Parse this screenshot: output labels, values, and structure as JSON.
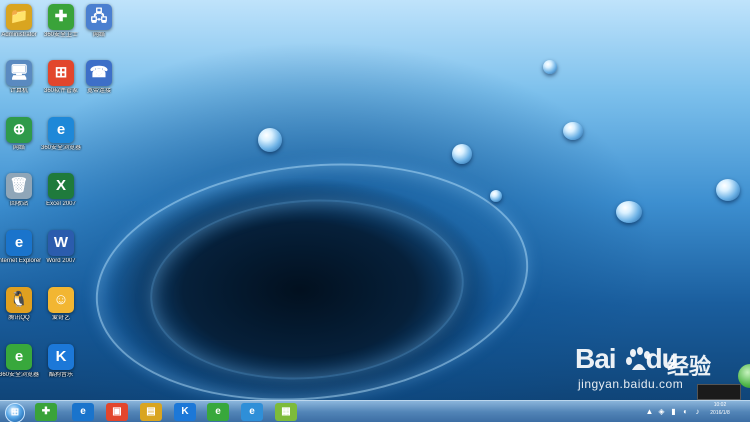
{
  "desktop_icons": [
    {
      "label": "Administrator",
      "color": "#d9a520",
      "glyph": "📁",
      "col": 0,
      "row": 0
    },
    {
      "label": "360安全卫士",
      "color": "#3aa33a",
      "glyph": "✚",
      "col": 1,
      "row": 0
    },
    {
      "label": "网络",
      "color": "#4a7fd0",
      "glyph": "🖧",
      "col": 2,
      "row": 0
    },
    {
      "label": "计算机",
      "color": "#5a8ac0",
      "glyph": "🖥",
      "col": 0,
      "row": 1
    },
    {
      "label": "360软件管家",
      "color": "#e2462c",
      "glyph": "⊞",
      "col": 1,
      "row": 1
    },
    {
      "label": "宽带连接",
      "color": "#3d6fc8",
      "glyph": "☎",
      "col": 2,
      "row": 1
    },
    {
      "label": "网络",
      "color": "#2f9a4a",
      "glyph": "⊕",
      "col": 0,
      "row": 2
    },
    {
      "label": "360安全浏览器",
      "color": "#1e88d8",
      "glyph": "e",
      "col": 1,
      "row": 2
    },
    {
      "label": "回收站",
      "color": "#8fa6b8",
      "glyph": "🗑",
      "col": 0,
      "row": 3
    },
    {
      "label": "Excel 2007",
      "color": "#1f7a3c",
      "glyph": "X",
      "col": 1,
      "row": 3
    },
    {
      "label": "Internet Explorer",
      "color": "#1a74cc",
      "glyph": "e",
      "col": 0,
      "row": 4
    },
    {
      "label": "Word 2007",
      "color": "#2b5cad",
      "glyph": "W",
      "col": 1,
      "row": 4
    },
    {
      "label": "腾讯QQ",
      "color": "#e0a020",
      "glyph": "🐧",
      "col": 0,
      "row": 5
    },
    {
      "label": "爱奇艺",
      "color": "#f2b632",
      "glyph": "☺",
      "col": 1,
      "row": 5
    },
    {
      "label": "360安全浏览器",
      "color": "#38a83c",
      "glyph": "e",
      "col": 0,
      "row": 6
    },
    {
      "label": "酷狗音乐",
      "color": "#1c78d8",
      "glyph": "K",
      "col": 1,
      "row": 6
    }
  ],
  "taskbar": {
    "start_glyph": "⊞",
    "pinned": [
      {
        "name": "360-safe-icon",
        "glyph": "✚",
        "color": "#3aa33a"
      },
      {
        "name": "ie-icon",
        "glyph": "e",
        "color": "#1a74cc"
      },
      {
        "name": "office-icon",
        "glyph": "▣",
        "color": "#e2462c"
      },
      {
        "name": "explorer-folder-icon",
        "glyph": "▤",
        "color": "#d9a520"
      },
      {
        "name": "kugou-icon",
        "glyph": "K",
        "color": "#1c78d8"
      },
      {
        "name": "360-browser-icon",
        "glyph": "e",
        "color": "#38a83c"
      },
      {
        "name": "ie-alt-icon",
        "glyph": "e",
        "color": "#2f8fd8"
      },
      {
        "name": "picture-icon",
        "glyph": "▦",
        "color": "#7dbb3a"
      }
    ],
    "tray_glyphs": [
      "▲",
      "◈",
      "▮",
      "◐",
      "♪"
    ],
    "popup_text": "",
    "clock_time": "10:02",
    "clock_date": "2016/1/8"
  },
  "watermark": {
    "brand_prefix": "Bai",
    "brand_suffix": "du",
    "brand_cn": "经验",
    "url": "jingyan.baidu.com"
  }
}
